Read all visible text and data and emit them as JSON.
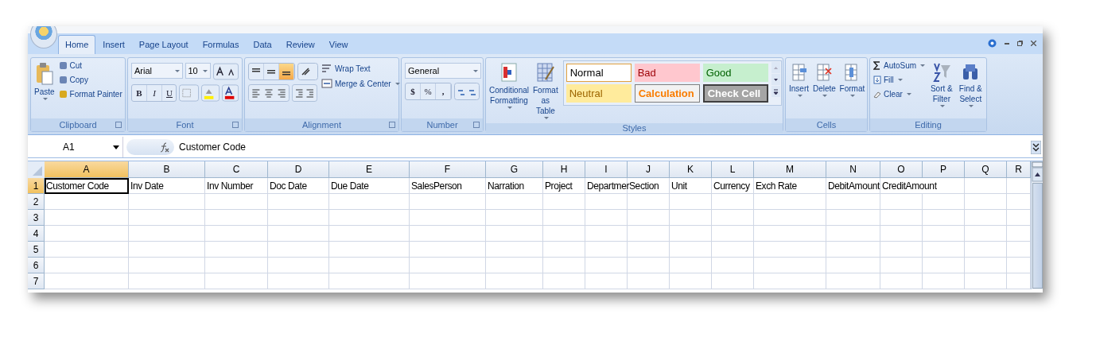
{
  "tabs": [
    {
      "label": "Home",
      "selected": true
    },
    {
      "label": "Insert",
      "selected": false
    },
    {
      "label": "Page Layout",
      "selected": false
    },
    {
      "label": "Formulas",
      "selected": false
    },
    {
      "label": "Data",
      "selected": false
    },
    {
      "label": "Review",
      "selected": false
    },
    {
      "label": "View",
      "selected": false
    }
  ],
  "ribbon": {
    "clipboard": {
      "label": "Clipboard",
      "paste": "Paste",
      "items": [
        "Cut",
        "Copy",
        "Format Painter"
      ]
    },
    "font": {
      "label": "Font",
      "font_name": "Arial",
      "font_size": "10",
      "bold": "B",
      "italic": "I",
      "underline": "U"
    },
    "alignment": {
      "label": "Alignment",
      "vertical_align": [
        {
          "kind": "top",
          "selected": false
        },
        {
          "kind": "middle",
          "selected": false
        },
        {
          "kind": "bottom",
          "selected": true
        }
      ],
      "wrap_text": "Wrap Text",
      "merge": "Merge & Center"
    },
    "number": {
      "label": "Number",
      "format": "General",
      "currency": "$",
      "percent": "%",
      "comma": ","
    },
    "styles": {
      "label": "Styles",
      "conditional": "Conditional Formatting",
      "table": "Format as Table",
      "cell_styles": [
        {
          "label": "Normal",
          "kind": "normal"
        },
        {
          "label": "Bad",
          "kind": "bad"
        },
        {
          "label": "Good",
          "kind": "good"
        },
        {
          "label": "Neutral",
          "kind": "neutral"
        },
        {
          "label": "Calculation",
          "kind": "calculation"
        },
        {
          "label": "Check Cell",
          "kind": "check"
        }
      ]
    },
    "cells": {
      "label": "Cells",
      "items": [
        "Insert",
        "Delete",
        "Format"
      ]
    },
    "editing": {
      "label": "Editing",
      "items": [
        "AutoSum",
        "Fill",
        "Clear"
      ],
      "sort": "Sort & Filter",
      "find": "Find & Select"
    }
  },
  "name_box": "A1",
  "formula": "Customer Code",
  "columns": [
    {
      "label": "A",
      "selected": true
    },
    {
      "label": "B",
      "selected": false
    },
    {
      "label": "C",
      "selected": false
    },
    {
      "label": "D",
      "selected": false
    },
    {
      "label": "E",
      "selected": false
    },
    {
      "label": "F",
      "selected": false
    },
    {
      "label": "G",
      "selected": false
    },
    {
      "label": "H",
      "selected": false
    },
    {
      "label": "I",
      "selected": false
    },
    {
      "label": "J",
      "selected": false
    },
    {
      "label": "K",
      "selected": false
    },
    {
      "label": "L",
      "selected": false
    },
    {
      "label": "M",
      "selected": false
    },
    {
      "label": "N",
      "selected": false
    },
    {
      "label": "O",
      "selected": false
    },
    {
      "label": "P",
      "selected": false
    },
    {
      "label": "Q",
      "selected": false
    },
    {
      "label": "R",
      "selected": false
    }
  ],
  "rows": [
    {
      "number": "1",
      "selected": true,
      "cells": [
        "Customer Code",
        "Inv Date",
        "Inv Number",
        "Doc Date",
        "Due Date",
        "SalesPerson",
        "Narration",
        "Project",
        "Departmer",
        "Section",
        "Unit",
        "Currency",
        "Exch Rate",
        "DebitAmount",
        "CreditAmount"
      ]
    },
    {
      "number": "2",
      "selected": false
    },
    {
      "number": "3",
      "selected": false
    },
    {
      "number": "4",
      "selected": false
    },
    {
      "number": "5",
      "selected": false
    },
    {
      "number": "6",
      "selected": false
    },
    {
      "number": "7",
      "selected": false
    }
  ]
}
